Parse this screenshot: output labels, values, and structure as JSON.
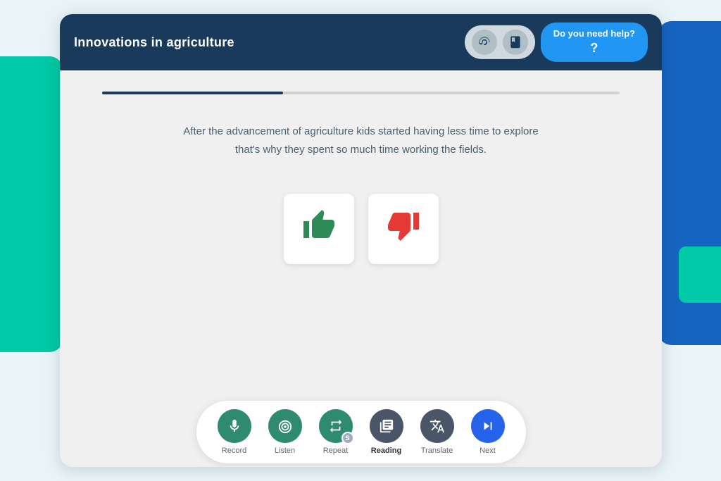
{
  "header": {
    "title": "Innovations in agriculture",
    "help_label": "Do you need help?",
    "help_icon": "?"
  },
  "icons": {
    "ear": "👂",
    "book": "📖",
    "mic": "🎙",
    "listen_waves": "◉",
    "repeat_arrows": "⇄",
    "repeat_badge": "S",
    "reading_icon": "▣",
    "translate_icon": "⊡",
    "next_icon": "⏭"
  },
  "passage": {
    "text": "After the advancement of agriculture kids started having less time to explore that's why they spent so much time working the fields."
  },
  "answer_options": {
    "thumbs_up_label": "Correct",
    "thumbs_down_label": "Incorrect"
  },
  "toolbar": {
    "items": [
      {
        "id": "record",
        "label": "Record"
      },
      {
        "id": "listen",
        "label": "Listen"
      },
      {
        "id": "repeat",
        "label": "Repeat"
      },
      {
        "id": "reading",
        "label": "Reading"
      },
      {
        "id": "translate",
        "label": "Translate"
      },
      {
        "id": "next",
        "label": "Next"
      }
    ]
  },
  "progress": {
    "fill_percent": 35
  }
}
